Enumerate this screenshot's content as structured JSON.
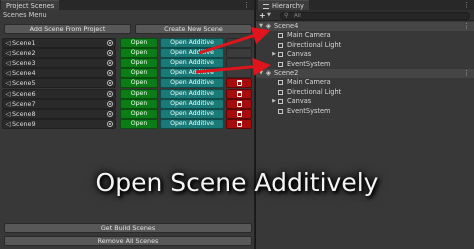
{
  "left_panel": {
    "tab_label": "Project Scenes",
    "menu_icon": "kebab-icon",
    "subtitle": "Scenes Menu",
    "add_scene_label": "Add Scene From Project",
    "create_scene_label": "Create New Scene",
    "open_label": "Open",
    "additive_label": "Open Additive",
    "scenes": [
      {
        "name": "Scene1",
        "removable": false
      },
      {
        "name": "Scene2",
        "removable": false
      },
      {
        "name": "Scene3",
        "removable": false
      },
      {
        "name": "Scene4",
        "removable": false
      },
      {
        "name": "Scene5",
        "removable": true
      },
      {
        "name": "Scene6",
        "removable": true
      },
      {
        "name": "Scene7",
        "removable": true
      },
      {
        "name": "Scene8",
        "removable": true
      },
      {
        "name": "Scene9",
        "removable": true
      }
    ],
    "get_build_label": "Get Build Scenes",
    "remove_all_label": "Remove All Scenes"
  },
  "hierarchy": {
    "tab_label": "Hierarchy",
    "menu_icon": "kebab-icon",
    "add_glyph": "+",
    "search_placeholder": "All",
    "scenes": [
      {
        "name": "Scene4",
        "expanded": true,
        "children": [
          {
            "name": "Main Camera",
            "foldout": false
          },
          {
            "name": "Directional Light",
            "foldout": false
          },
          {
            "name": "Canvas",
            "foldout": true
          },
          {
            "name": "EventSystem",
            "foldout": false
          }
        ]
      },
      {
        "name": "Scene2",
        "expanded": true,
        "children": [
          {
            "name": "Main Camera",
            "foldout": false
          },
          {
            "name": "Directional Light",
            "foldout": false
          },
          {
            "name": "Canvas",
            "foldout": true
          },
          {
            "name": "EventSystem",
            "foldout": false
          }
        ]
      }
    ]
  },
  "overlay": {
    "banner_text": "Open Scene Additively",
    "arrow_color": "#e0141b"
  },
  "colors": {
    "open_button": "#0c7c16",
    "additive_button": "#1a7a78",
    "remove_button": "#a50d0d"
  }
}
